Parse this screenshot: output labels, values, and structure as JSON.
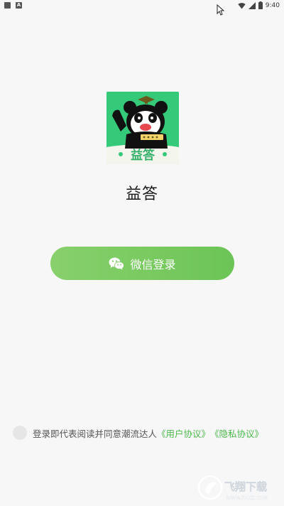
{
  "status_bar": {
    "time": "9:40"
  },
  "app": {
    "name": "益答",
    "logo_text": "益答"
  },
  "login": {
    "wechat_button_label": "微信登录",
    "wechat_icon": "wechat-icon"
  },
  "agreement": {
    "text": "登录即代表阅读并同意潮流达人",
    "user_agreement_link": "《用户协议》",
    "privacy_link": "《隐私协议》"
  },
  "watermark": {
    "text": "飞翔下载",
    "url": "WWW.FXXZ.COM"
  },
  "colors": {
    "background": "#f7f7f7",
    "button_start": "#88d06c",
    "button_end": "#6cc456",
    "link": "#4bb84a",
    "logo_bg": "#35c97a"
  }
}
